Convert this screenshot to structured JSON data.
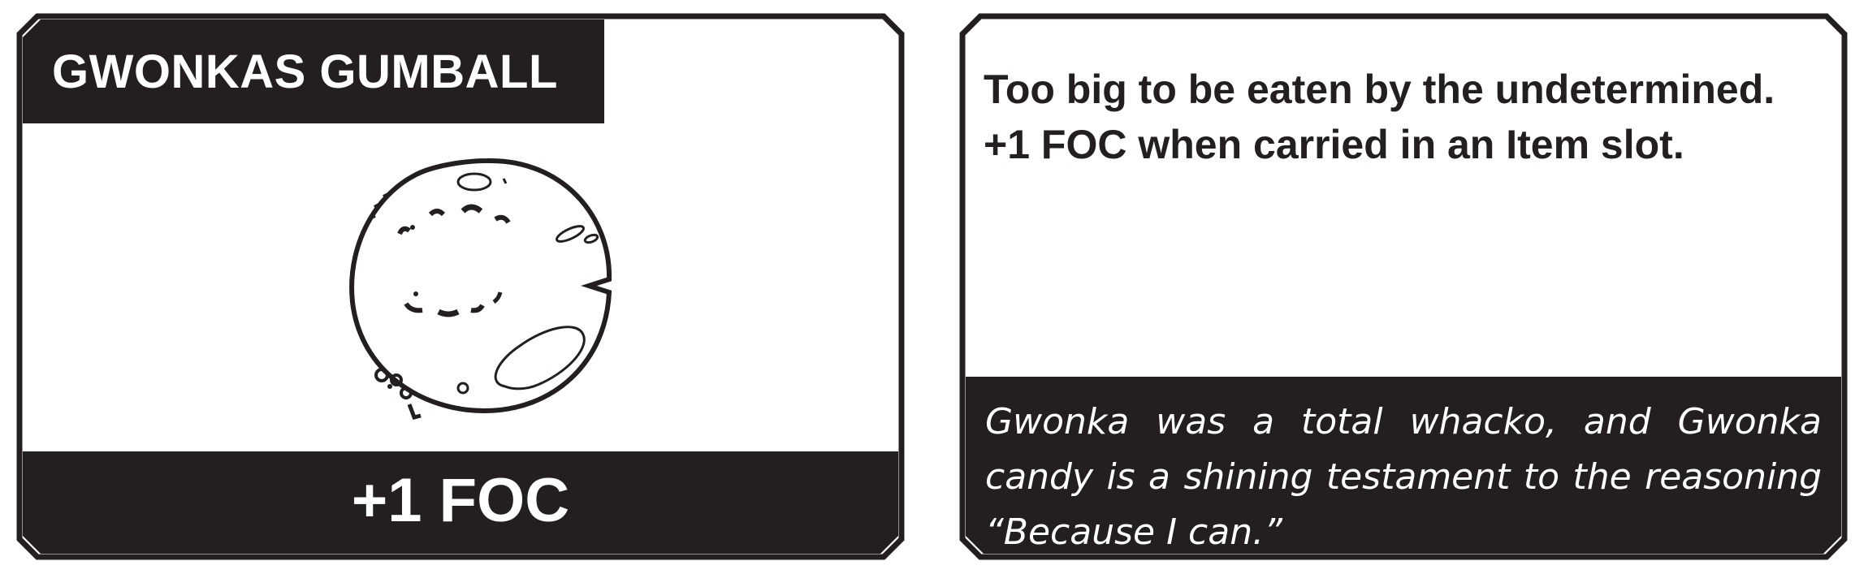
{
  "front_card": {
    "name": "GWONKAS GUMBALL",
    "stat": "+1 FOC",
    "art_icon": "gumball-sketch-icon"
  },
  "back_card": {
    "effect_line_1": "Too big to be eaten by the undetermined.",
    "effect_line_2": "+1 FOC when carried in an Item slot.",
    "flavor_text": "Gwonka was a total whacko, and Gwonka candy is a shining testament to the reasoning “Because I can.”"
  },
  "colors": {
    "ink": "#231f20",
    "paper": "#ffffff"
  }
}
